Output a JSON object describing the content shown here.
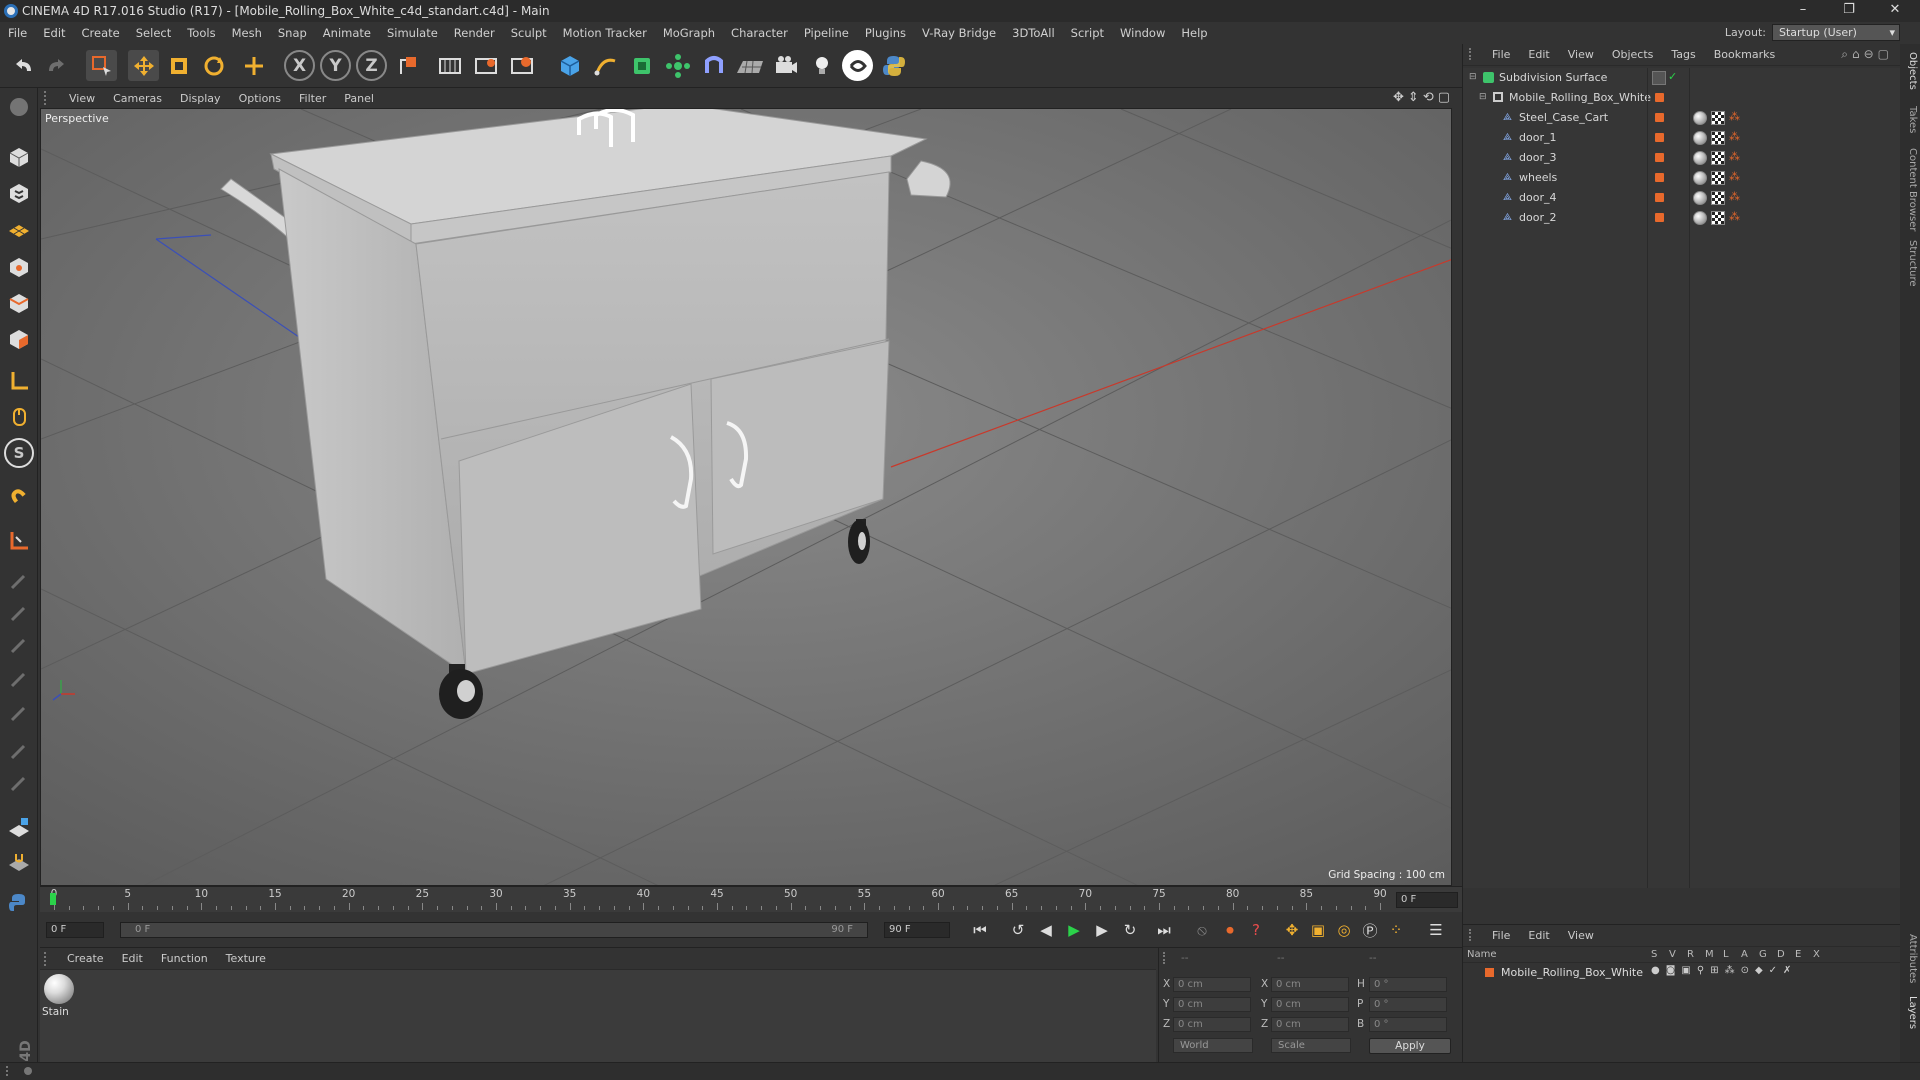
{
  "window": {
    "title": "CINEMA 4D R17.016 Studio (R17) - [Mobile_Rolling_Box_White_c4d_standart.c4d] - Main",
    "controls": [
      "–",
      "❐",
      "✕"
    ]
  },
  "menubar": {
    "items": [
      "File",
      "Edit",
      "Create",
      "Select",
      "Tools",
      "Mesh",
      "Snap",
      "Animate",
      "Simulate",
      "Render",
      "Sculpt",
      "Motion Tracker",
      "MoGraph",
      "Character",
      "Pipeline",
      "Plugins",
      "V-Ray Bridge",
      "3DToAll",
      "Script",
      "Window",
      "Help"
    ],
    "layout_label": "Layout:",
    "layout_value": "Startup (User)"
  },
  "toolbar": {
    "axis_x": "X",
    "axis_y": "Y",
    "axis_z": "Z",
    "icons": [
      "undo-icon",
      "redo-icon",
      "live-selection-icon",
      "move-icon",
      "scale-icon",
      "rotate-icon",
      "last-tool-icon",
      "x-axis-lock-icon",
      "y-axis-lock-icon",
      "z-axis-lock-icon",
      "coordinate-system-icon",
      "render-view-icon",
      "render-picture-viewer-icon",
      "render-settings-icon",
      "cube-primitive-icon",
      "spline-pen-icon",
      "subdivision-surface-icon",
      "array-icon",
      "deformer-icon",
      "floor-icon",
      "camera-icon",
      "light-icon",
      "vray-icon",
      "python-icon"
    ]
  },
  "viewport": {
    "menu": [
      "View",
      "Cameras",
      "Display",
      "Options",
      "Filter",
      "Panel"
    ],
    "label": "Perspective",
    "grid_spacing": "Grid Spacing : 100 cm"
  },
  "timeline": {
    "ticks": [
      "0",
      "5",
      "10",
      "15",
      "20",
      "25",
      "30",
      "35",
      "40",
      "45",
      "50",
      "55",
      "60",
      "65",
      "70",
      "75",
      "80",
      "85",
      "90"
    ],
    "current_frame": "0 F",
    "start_field": "0 F",
    "range_start": "0 F",
    "range_end": "90 F",
    "end_field": "90 F"
  },
  "material_manager": {
    "menu": [
      "Create",
      "Edit",
      "Function",
      "Texture"
    ],
    "materials": [
      {
        "name": "Stain"
      }
    ]
  },
  "coordinates": {
    "header": [
      "--",
      "--",
      "--"
    ],
    "pos": {
      "x_label": "X",
      "y_label": "Y",
      "z_label": "Z",
      "x": "0 cm",
      "y": "0 cm",
      "z": "0 cm"
    },
    "size": {
      "x_label": "X",
      "y_label": "Y",
      "z_label": "Z",
      "x": "0 cm",
      "y": "0 cm",
      "z": "0 cm"
    },
    "rot": {
      "h_label": "H",
      "p_label": "P",
      "b_label": "B",
      "h": "0 °",
      "p": "0 °",
      "b": "0 °"
    },
    "world_dropdown": "World",
    "scale_dropdown": "Scale",
    "apply": "Apply"
  },
  "object_manager": {
    "menu": [
      "File",
      "Edit",
      "View",
      "Objects",
      "Tags",
      "Bookmarks"
    ],
    "objects": [
      {
        "name": "Subdivision Surface",
        "level": 0
      },
      {
        "name": "Mobile_Rolling_Box_White",
        "level": 1
      },
      {
        "name": "Steel_Case_Cart",
        "level": 2
      },
      {
        "name": "door_1",
        "level": 2
      },
      {
        "name": "door_3",
        "level": 2
      },
      {
        "name": "wheels",
        "level": 2
      },
      {
        "name": "door_4",
        "level": 2
      },
      {
        "name": "door_2",
        "level": 2
      }
    ]
  },
  "layer_manager": {
    "menu": [
      "File",
      "Edit",
      "View"
    ],
    "columns": [
      "Name",
      "S",
      "V",
      "R",
      "M",
      "L",
      "A",
      "G",
      "D",
      "E",
      "X"
    ],
    "layers": [
      {
        "name": "Mobile_Rolling_Box_White"
      }
    ]
  },
  "side_tabs": [
    "Objects",
    "Takes",
    "Content Browser",
    "Structure",
    "Attributes",
    "Layers"
  ],
  "colors": {
    "accent_orange": "#e8692c",
    "timeline_cursor": "#2bd24a",
    "axis_red": "#c8392b",
    "axis_blue": "#3a4fb8"
  }
}
